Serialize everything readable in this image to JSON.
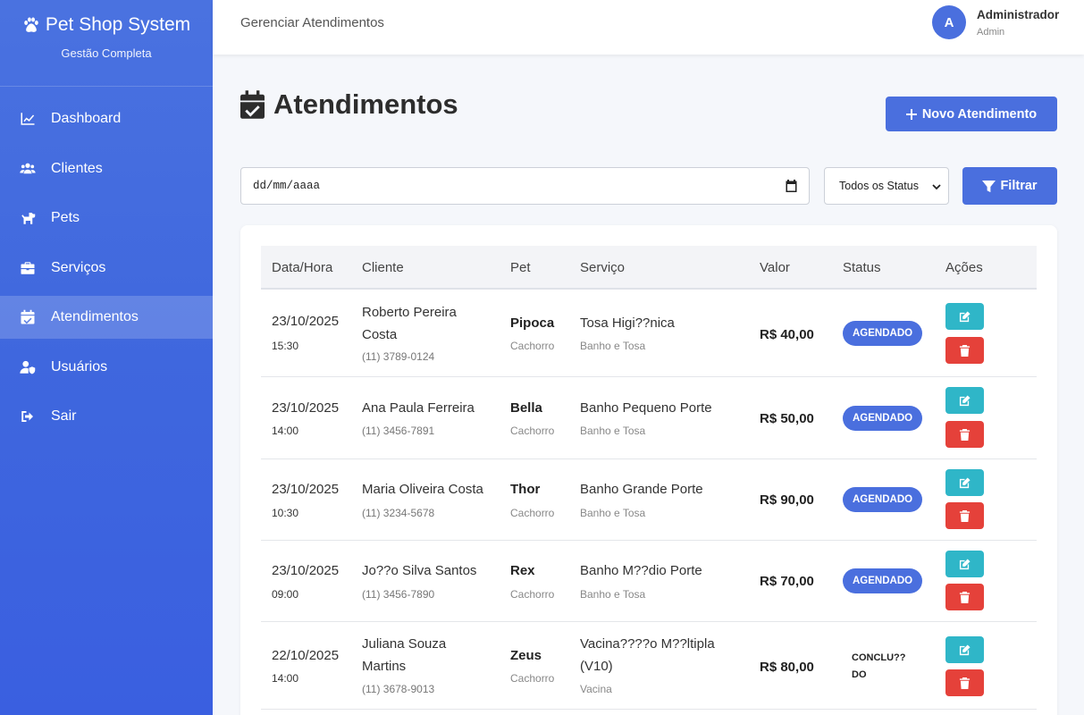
{
  "sidebar": {
    "brand": "Pet Shop System",
    "subtitle": "Gestão Completa",
    "items": [
      {
        "label": "Dashboard",
        "icon": "chart-line-icon"
      },
      {
        "label": "Clientes",
        "icon": "users-icon"
      },
      {
        "label": "Pets",
        "icon": "dog-icon"
      },
      {
        "label": "Serviços",
        "icon": "briefcase-icon"
      },
      {
        "label": "Atendimentos",
        "icon": "calendar-check-icon",
        "active": true
      },
      {
        "label": "Usuários",
        "icon": "user-shield-icon"
      },
      {
        "label": "Sair",
        "icon": "sign-out-icon"
      }
    ]
  },
  "header": {
    "breadcrumb": "Gerenciar Atendimentos",
    "avatar_letter": "A",
    "user_name": "Administrador",
    "user_role": "Admin"
  },
  "main": {
    "title": "Atendimentos",
    "new_button": "Novo Atendimento",
    "date_placeholder": "dd/mm/aaaa",
    "status_selected": "Todos os Status",
    "filter_button": "Filtrar"
  },
  "table": {
    "headers": [
      "Data/Hora",
      "Cliente",
      "Pet",
      "Serviço",
      "Valor",
      "Status",
      "Ações"
    ],
    "rows": [
      {
        "date": "23/10/2025",
        "time": "15:30",
        "client": "Roberto Pereira Costa",
        "phone": "(11) 3789-0124",
        "pet": "Pipoca",
        "species": "Cachorro",
        "service": "Tosa Higi??nica",
        "category": "Banho e Tosa",
        "price": "R$ 40,00",
        "status": "AGENDADO"
      },
      {
        "date": "23/10/2025",
        "time": "14:00",
        "client": "Ana Paula Ferreira",
        "phone": "(11) 3456-7891",
        "pet": "Bella",
        "species": "Cachorro",
        "service": "Banho Pequeno Porte",
        "category": "Banho e Tosa",
        "price": "R$ 50,00",
        "status": "AGENDADO"
      },
      {
        "date": "23/10/2025",
        "time": "10:30",
        "client": "Maria Oliveira Costa",
        "phone": "(11) 3234-5678",
        "pet": "Thor",
        "species": "Cachorro",
        "service": "Banho Grande Porte",
        "category": "Banho e Tosa",
        "price": "R$ 90,00",
        "status": "AGENDADO"
      },
      {
        "date": "23/10/2025",
        "time": "09:00",
        "client": "Jo??o Silva Santos",
        "phone": "(11) 3456-7890",
        "pet": "Rex",
        "species": "Cachorro",
        "service": "Banho M??dio Porte",
        "category": "Banho e Tosa",
        "price": "R$ 70,00",
        "status": "AGENDADO"
      },
      {
        "date": "22/10/2025",
        "time": "14:00",
        "client": "Juliana Souza Martins",
        "phone": "(11) 3678-9013",
        "pet": "Zeus",
        "species": "Cachorro",
        "service": "Vacina????o M??ltipla (V10)",
        "category": "Vacina",
        "price": "R$ 80,00",
        "status": "CONCLU??DO"
      }
    ]
  },
  "colors": {
    "primary": "#4a6fde",
    "edit": "#2fb6c8",
    "delete": "#e5413a"
  }
}
